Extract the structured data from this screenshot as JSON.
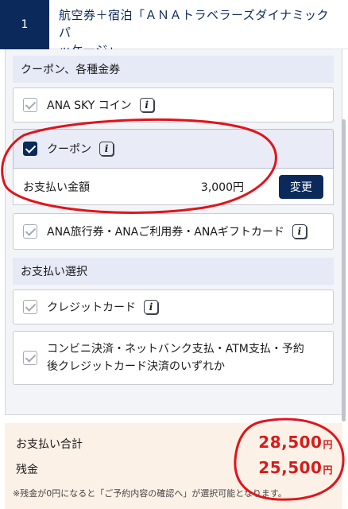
{
  "header": {
    "step_number": "1",
    "title_line1": "航空券＋宿泊「ＡＮＡトラベラーズダイナミックパ",
    "title_line2": "ッケージ」"
  },
  "coupon_section": {
    "heading": "クーポン、各種金券",
    "options": [
      {
        "label": "ANA SKY コイン",
        "checked": false,
        "info_icon": "i"
      },
      {
        "label": "クーポン",
        "checked": true,
        "info_icon": "i"
      },
      {
        "label": "ANA旅行券・ANAご利用券・ANAギフトカード",
        "checked": false,
        "info_icon": "i"
      }
    ],
    "payment_row": {
      "label": "お支払い金額",
      "amount": "3,000円",
      "change_button": "変更"
    }
  },
  "payment_section": {
    "heading": "お支払い選択",
    "options": [
      {
        "label": "クレジットカード",
        "checked": false,
        "info_icon": "i"
      },
      {
        "label_line1": "コンビニ決済・ネットバンク支払・ATM支払・予約",
        "label_line2": "後クレジットカード決済のいずれか",
        "checked": false
      }
    ]
  },
  "summary": {
    "total_label": "お支払い合計",
    "total_value": "28,500",
    "balance_label": "残金",
    "balance_value": "25,500",
    "currency": "円",
    "note": "※残金が0円になると「ご予約内容の確認へ」が選択可能となります。"
  },
  "colors": {
    "brand_navy": "#0b2a5b",
    "section_bg": "#e6e9f6",
    "footer_bg": "#fcf1e7",
    "price_red": "#d71c1c",
    "annotation_red": "#e0141b"
  }
}
